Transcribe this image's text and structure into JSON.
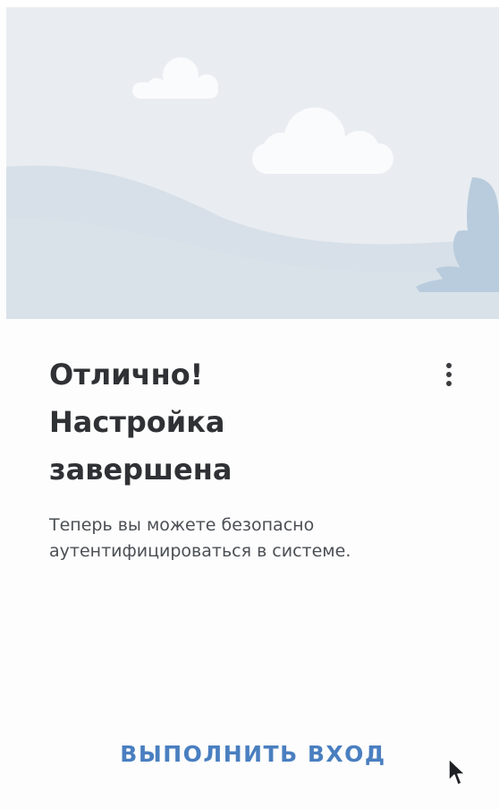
{
  "hero": {
    "icon": "landscape-illustration",
    "colors": {
      "sky": "#e9edf1",
      "cloud": "#fafbfc",
      "hill": "#d4dee7",
      "plant": "#b8cbdc"
    }
  },
  "card": {
    "title_lines": [
      "Отлично!",
      "Настройка",
      "завершена"
    ],
    "description_lines": [
      "Теперь вы можете безопасно",
      "аутентифицироваться в системе."
    ],
    "menu_icon": "more-vertical-icon",
    "login_label": "ВЫПОЛНИТЬ ВХОД"
  },
  "colors": {
    "title": "#2f3134",
    "text": "#4b4f54",
    "accent": "#4a7fc0"
  }
}
